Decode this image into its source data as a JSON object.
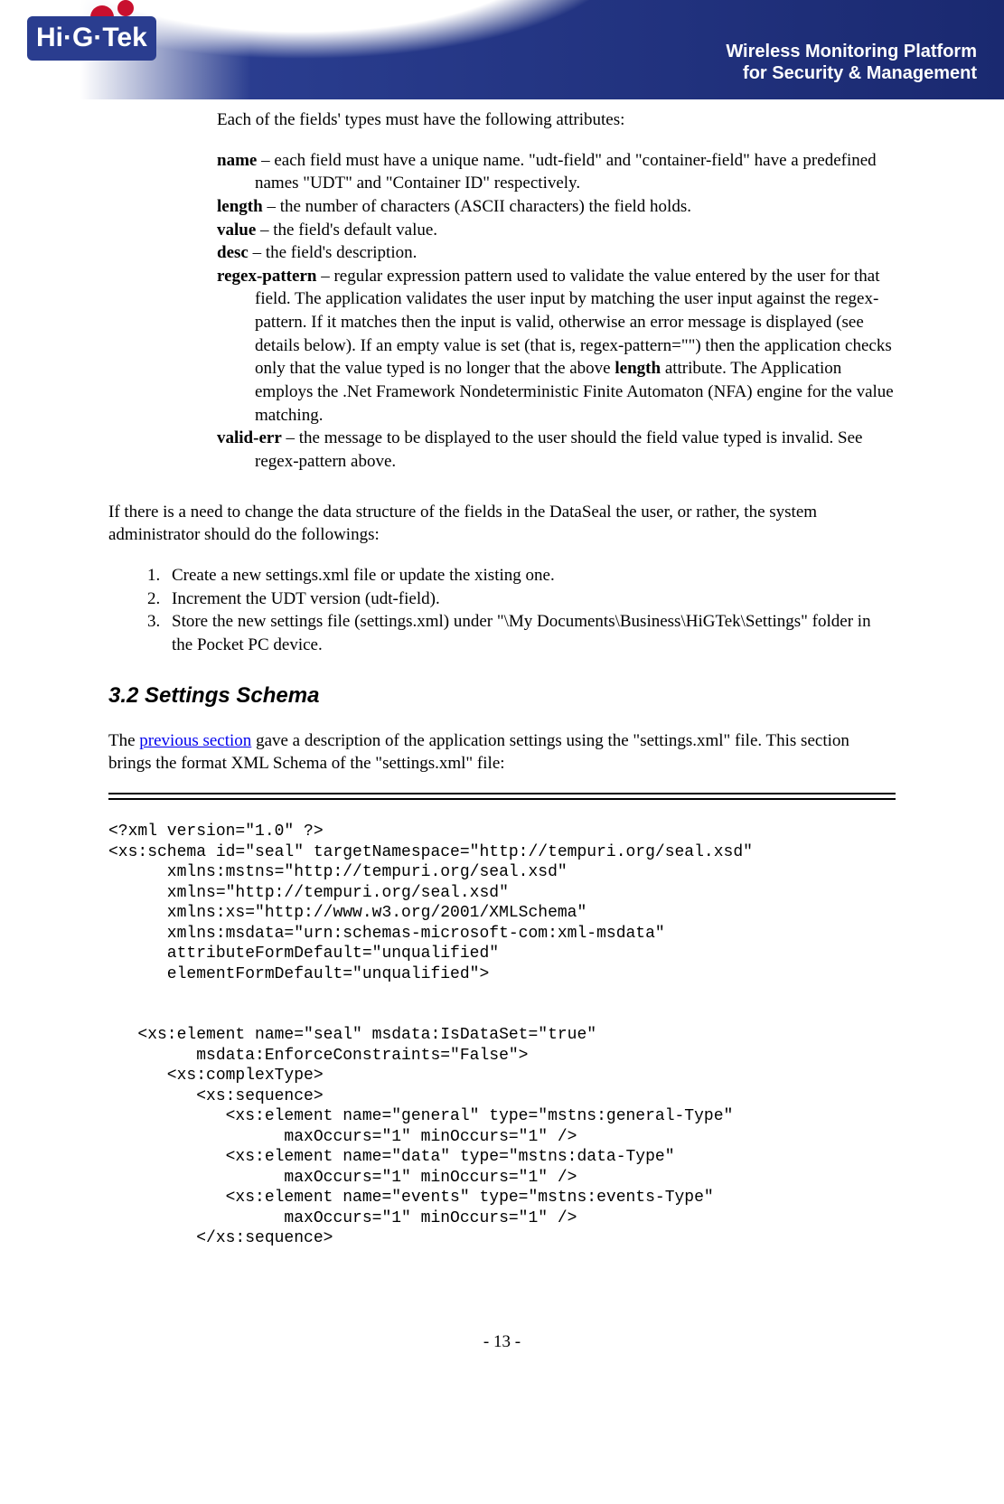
{
  "header": {
    "logo_text": "Hi·G·Tek",
    "tagline_line1": "Wireless Monitoring Platform",
    "tagline_line2": "for Security & Management"
  },
  "intro_line": "Each of the fields' types must have the following attributes:",
  "attrs": {
    "name_label": "name",
    "name_text": " – each field must have a unique name. \"udt-field\" and \"container-field\" have a predefined names \"UDT\" and \"Container ID\" respectively.",
    "length_label": "length",
    "length_text": " – the number of characters (ASCII characters)  the field holds.",
    "value_label": "value",
    "value_text": " – the field's default value.",
    "desc_label": "desc",
    "desc_text": " – the field's description.",
    "regex_label": "regex-pattern",
    "regex_text_a": " – regular expression pattern used to validate the value entered by the user for that field. The application validates the user input by matching the user input against the regex-pattern. If it matches then the input is valid, otherwise an error message is displayed (see details below).  If an empty value is set (that is, regex-pattern=\"\") then the application checks only that the value typed is no longer that the above ",
    "regex_bold": "length",
    "regex_text_b": " attribute. The Application employs the .Net Framework Nondeterministic Finite Automaton (NFA) engine for the value matching.",
    "valid_label": "valid-err",
    "valid_text": " – the message to be displayed to the user should the field value typed is invalid. See regex-pattern above."
  },
  "admin_para": "If there is a need to change the data structure of the fields in the DataSeal the user, or rather, the system administrator should do the followings:",
  "steps": [
    "Create a new settings.xml file or update the xisting one.",
    "Increment the UDT version (udt-field).",
    "Store the new settings file (settings.xml) under \"\\My Documents\\Business\\HiGTek\\Settings\" folder in the Pocket PC device."
  ],
  "section_heading": "3.2  Settings Schema",
  "schema_para_a": "The ",
  "schema_link": "previous section",
  "schema_para_b": " gave a description of the application settings using the \"settings.xml\" file. This section brings the format XML Schema of the \"settings.xml\" file:",
  "code": "<?xml version=\"1.0\" ?>\n<xs:schema id=\"seal\" targetNamespace=\"http://tempuri.org/seal.xsd\"\n      xmlns:mstns=\"http://tempuri.org/seal.xsd\"\n      xmlns=\"http://tempuri.org/seal.xsd\"\n      xmlns:xs=\"http://www.w3.org/2001/XMLSchema\"\n      xmlns:msdata=\"urn:schemas-microsoft-com:xml-msdata\"\n      attributeFormDefault=\"unqualified\"\n      elementFormDefault=\"unqualified\">\n\n\n   <xs:element name=\"seal\" msdata:IsDataSet=\"true\"\n         msdata:EnforceConstraints=\"False\">\n      <xs:complexType>\n         <xs:sequence>\n            <xs:element name=\"general\" type=\"mstns:general-Type\"\n                  maxOccurs=\"1\" minOccurs=\"1\" />\n            <xs:element name=\"data\" type=\"mstns:data-Type\"\n                  maxOccurs=\"1\" minOccurs=\"1\" />\n            <xs:element name=\"events\" type=\"mstns:events-Type\"\n                  maxOccurs=\"1\" minOccurs=\"1\" />\n         </xs:sequence>",
  "footer": "- 13 -"
}
